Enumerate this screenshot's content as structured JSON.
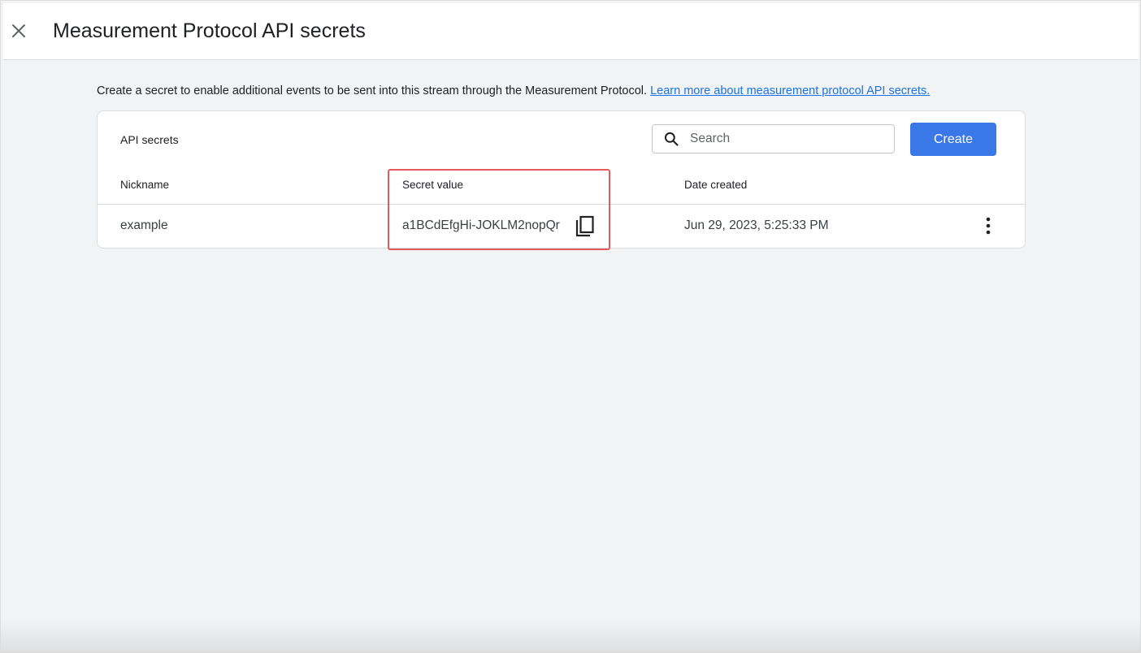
{
  "header": {
    "title": "Measurement Protocol API secrets",
    "close_icon": "close-icon"
  },
  "intro": {
    "text": "Create a secret to enable additional events to be sent into this stream through the Measurement Protocol.",
    "link_label": "Learn more about measurement protocol API secrets."
  },
  "card": {
    "title": "API secrets",
    "search": {
      "placeholder": "Search",
      "value": "",
      "icon": "search-icon"
    },
    "create_label": "Create",
    "columns": {
      "nickname": "Nickname",
      "secret_value": "Secret value",
      "date_created": "Date created"
    },
    "rows": [
      {
        "nickname": "example",
        "secret_value": "a1BCdEfgHi-JOKLM2nopQr",
        "date_created": "Jun 29, 2023, 5:25:33 PM",
        "copy_icon": "copy-icon",
        "more_icon": "more-vert-icon"
      }
    ]
  },
  "colors": {
    "accent": "#3b78e7",
    "link": "#1a73e8",
    "highlight_border": "#e35b5b",
    "page_background": "#f1f3f4"
  }
}
